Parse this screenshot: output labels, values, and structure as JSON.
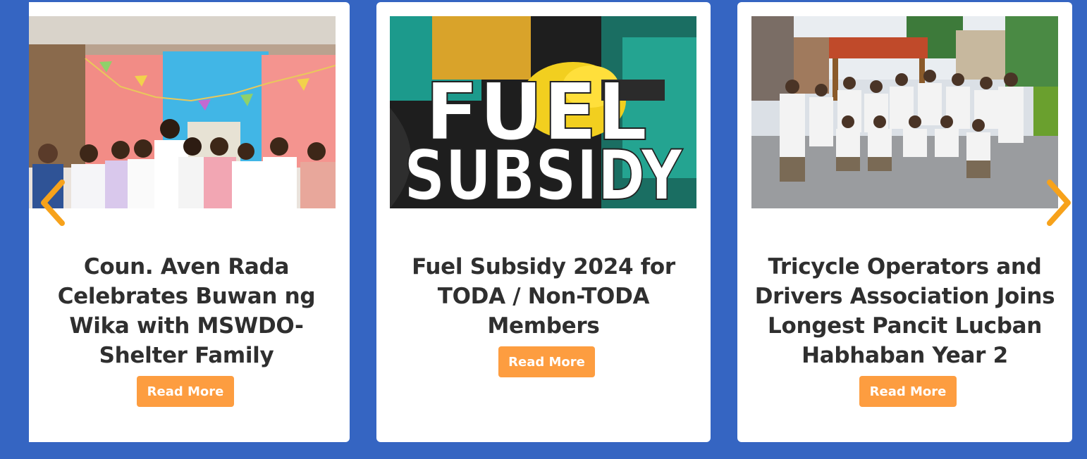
{
  "colors": {
    "background": "#3565c2",
    "card": "#ffffff",
    "button": "#fd9d40",
    "arrow": "#f7a21b",
    "title": "#2f2f2f"
  },
  "carousel": {
    "prev_icon": "chevron-left-icon",
    "next_icon": "chevron-right-icon",
    "cards": [
      {
        "image_alt": "photo",
        "title": "Coun. Aven Rada Celebrates Buwan ng Wika with MSWDO-Shelter Family",
        "button_label": "Read More"
      },
      {
        "image_alt": "photo",
        "image_text_line1": "FUEL",
        "image_text_line2": "SUBSIDY",
        "title": "Fuel Subsidy 2024 for TODA / Non-TODA Members",
        "button_label": "Read More"
      },
      {
        "image_alt": "photo",
        "title": "Tricycle Operators and Drivers Association Joins Longest Pancit Lucban Habhaban Year 2",
        "button_label": "Read More"
      }
    ]
  }
}
